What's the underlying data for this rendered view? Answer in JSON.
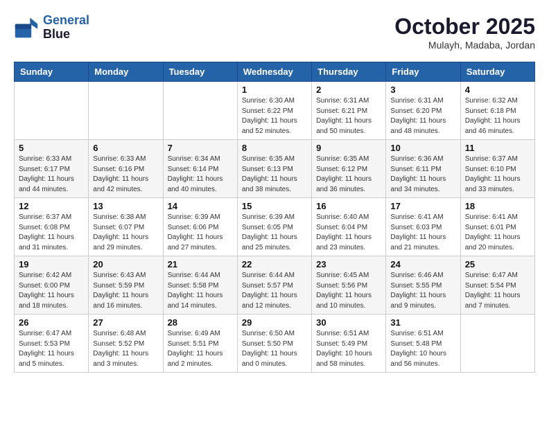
{
  "header": {
    "logo_line1": "General",
    "logo_line2": "Blue",
    "month": "October 2025",
    "location": "Mulayh, Madaba, Jordan"
  },
  "days_of_week": [
    "Sunday",
    "Monday",
    "Tuesday",
    "Wednesday",
    "Thursday",
    "Friday",
    "Saturday"
  ],
  "weeks": [
    [
      {
        "day": "",
        "info": ""
      },
      {
        "day": "",
        "info": ""
      },
      {
        "day": "",
        "info": ""
      },
      {
        "day": "1",
        "info": "Sunrise: 6:30 AM\nSunset: 6:22 PM\nDaylight: 11 hours\nand 52 minutes."
      },
      {
        "day": "2",
        "info": "Sunrise: 6:31 AM\nSunset: 6:21 PM\nDaylight: 11 hours\nand 50 minutes."
      },
      {
        "day": "3",
        "info": "Sunrise: 6:31 AM\nSunset: 6:20 PM\nDaylight: 11 hours\nand 48 minutes."
      },
      {
        "day": "4",
        "info": "Sunrise: 6:32 AM\nSunset: 6:18 PM\nDaylight: 11 hours\nand 46 minutes."
      }
    ],
    [
      {
        "day": "5",
        "info": "Sunrise: 6:33 AM\nSunset: 6:17 PM\nDaylight: 11 hours\nand 44 minutes."
      },
      {
        "day": "6",
        "info": "Sunrise: 6:33 AM\nSunset: 6:16 PM\nDaylight: 11 hours\nand 42 minutes."
      },
      {
        "day": "7",
        "info": "Sunrise: 6:34 AM\nSunset: 6:14 PM\nDaylight: 11 hours\nand 40 minutes."
      },
      {
        "day": "8",
        "info": "Sunrise: 6:35 AM\nSunset: 6:13 PM\nDaylight: 11 hours\nand 38 minutes."
      },
      {
        "day": "9",
        "info": "Sunrise: 6:35 AM\nSunset: 6:12 PM\nDaylight: 11 hours\nand 36 minutes."
      },
      {
        "day": "10",
        "info": "Sunrise: 6:36 AM\nSunset: 6:11 PM\nDaylight: 11 hours\nand 34 minutes."
      },
      {
        "day": "11",
        "info": "Sunrise: 6:37 AM\nSunset: 6:10 PM\nDaylight: 11 hours\nand 33 minutes."
      }
    ],
    [
      {
        "day": "12",
        "info": "Sunrise: 6:37 AM\nSunset: 6:08 PM\nDaylight: 11 hours\nand 31 minutes."
      },
      {
        "day": "13",
        "info": "Sunrise: 6:38 AM\nSunset: 6:07 PM\nDaylight: 11 hours\nand 29 minutes."
      },
      {
        "day": "14",
        "info": "Sunrise: 6:39 AM\nSunset: 6:06 PM\nDaylight: 11 hours\nand 27 minutes."
      },
      {
        "day": "15",
        "info": "Sunrise: 6:39 AM\nSunset: 6:05 PM\nDaylight: 11 hours\nand 25 minutes."
      },
      {
        "day": "16",
        "info": "Sunrise: 6:40 AM\nSunset: 6:04 PM\nDaylight: 11 hours\nand 23 minutes."
      },
      {
        "day": "17",
        "info": "Sunrise: 6:41 AM\nSunset: 6:03 PM\nDaylight: 11 hours\nand 21 minutes."
      },
      {
        "day": "18",
        "info": "Sunrise: 6:41 AM\nSunset: 6:01 PM\nDaylight: 11 hours\nand 20 minutes."
      }
    ],
    [
      {
        "day": "19",
        "info": "Sunrise: 6:42 AM\nSunset: 6:00 PM\nDaylight: 11 hours\nand 18 minutes."
      },
      {
        "day": "20",
        "info": "Sunrise: 6:43 AM\nSunset: 5:59 PM\nDaylight: 11 hours\nand 16 minutes."
      },
      {
        "day": "21",
        "info": "Sunrise: 6:44 AM\nSunset: 5:58 PM\nDaylight: 11 hours\nand 14 minutes."
      },
      {
        "day": "22",
        "info": "Sunrise: 6:44 AM\nSunset: 5:57 PM\nDaylight: 11 hours\nand 12 minutes."
      },
      {
        "day": "23",
        "info": "Sunrise: 6:45 AM\nSunset: 5:56 PM\nDaylight: 11 hours\nand 10 minutes."
      },
      {
        "day": "24",
        "info": "Sunrise: 6:46 AM\nSunset: 5:55 PM\nDaylight: 11 hours\nand 9 minutes."
      },
      {
        "day": "25",
        "info": "Sunrise: 6:47 AM\nSunset: 5:54 PM\nDaylight: 11 hours\nand 7 minutes."
      }
    ],
    [
      {
        "day": "26",
        "info": "Sunrise: 6:47 AM\nSunset: 5:53 PM\nDaylight: 11 hours\nand 5 minutes."
      },
      {
        "day": "27",
        "info": "Sunrise: 6:48 AM\nSunset: 5:52 PM\nDaylight: 11 hours\nand 3 minutes."
      },
      {
        "day": "28",
        "info": "Sunrise: 6:49 AM\nSunset: 5:51 PM\nDaylight: 11 hours\nand 2 minutes."
      },
      {
        "day": "29",
        "info": "Sunrise: 6:50 AM\nSunset: 5:50 PM\nDaylight: 11 hours\nand 0 minutes."
      },
      {
        "day": "30",
        "info": "Sunrise: 6:51 AM\nSunset: 5:49 PM\nDaylight: 10 hours\nand 58 minutes."
      },
      {
        "day": "31",
        "info": "Sunrise: 6:51 AM\nSunset: 5:48 PM\nDaylight: 10 hours\nand 56 minutes."
      },
      {
        "day": "",
        "info": ""
      }
    ]
  ]
}
